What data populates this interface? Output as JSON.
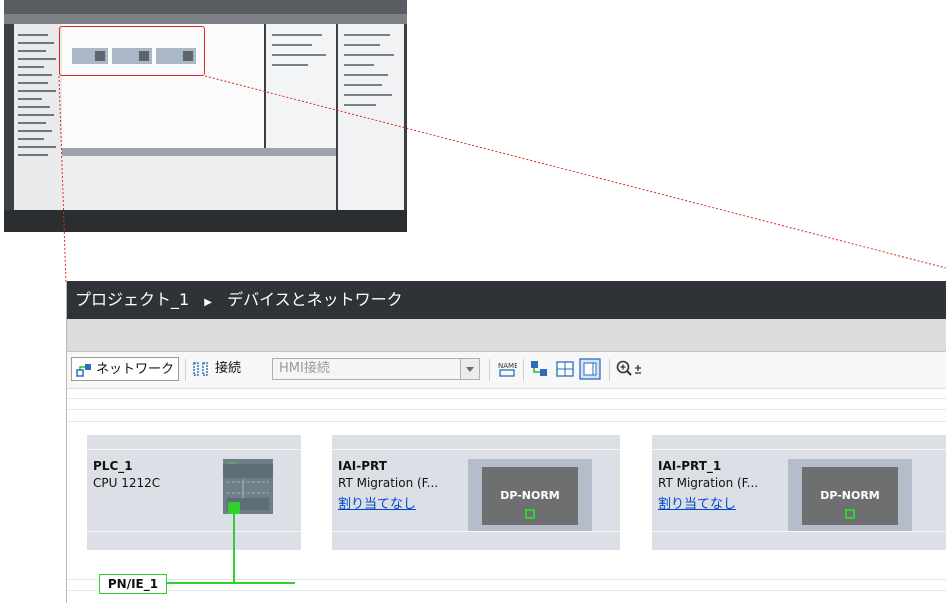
{
  "title": {
    "project": "プロジェクト_1",
    "separator": "▶",
    "page": "デバイスとネットワーク"
  },
  "toolbar": {
    "network_label": "ネットワーク",
    "connection_label": "接続",
    "hmi_placeholder": "HMI接続",
    "icons": [
      "network-view-icon",
      "connection-icon",
      "dropdown-arrow-icon",
      "name-icon",
      "station-icon",
      "table-icon",
      "overview-icon",
      "zoom-in-icon"
    ]
  },
  "devices": [
    {
      "name": "PLC_1",
      "type": "CPU 1212C"
    },
    {
      "name": "IAI-PRT",
      "type": "RT Migration (F...",
      "link": "割り当てなし",
      "module": "DP-NORM"
    },
    {
      "name": "IAI-PRT_1",
      "type": "RT Migration (F...",
      "link": "割り当てなし",
      "module": "DP-NORM"
    }
  ],
  "network": {
    "label": "PN/IE_1"
  },
  "colors": {
    "highlight": "#e0261f",
    "network": "#2fd02f",
    "title_bar": "#2f3338",
    "link": "#0046c8"
  }
}
